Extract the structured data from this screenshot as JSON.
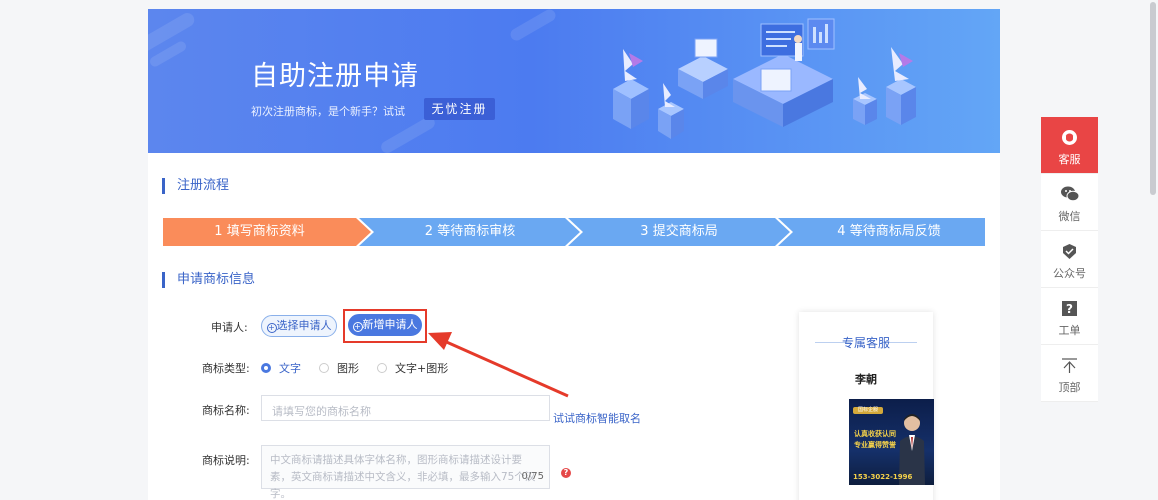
{
  "banner": {
    "title": "自助注册申请",
    "subtitle": "初次注册商标，是个新手？试试",
    "cta": "无忧注册"
  },
  "section_process": {
    "title": "注册流程"
  },
  "steps": [
    {
      "label": "1 填写商标资料",
      "color": "#fa8c5a"
    },
    {
      "label": "2 等待商标审核",
      "color": "#6aa8f2"
    },
    {
      "label": "3 提交商标局",
      "color": "#6aa8f2"
    },
    {
      "label": "4 等待商标局反馈",
      "color": "#6aa8f2"
    }
  ],
  "section_info": {
    "title": "申请商标信息"
  },
  "form": {
    "applicant": {
      "label": "申请人:",
      "select_button": "选择申请人",
      "add_button": "新增申请人"
    },
    "mark_type": {
      "label": "商标类型:",
      "options": [
        "文字",
        "图形",
        "文字+图形"
      ],
      "selected": "文字"
    },
    "mark_name": {
      "label": "商标名称:",
      "placeholder": "请填写您的商标名称",
      "ai_link": "试试商标智能取名"
    },
    "mark_desc": {
      "label": "商标说明:",
      "placeholder": "中文商标请描述具体字体名称，图形商标请描述设计要素，英文商标请描述中文含义，非必填，最多输入75个汉字。",
      "counter": "0/75",
      "help": "?"
    }
  },
  "service_card": {
    "title": "专属客服",
    "name": "李朝",
    "photo": {
      "badge": "国标企服",
      "line1": "认真收获认同",
      "line2": "专业赢得赞誉",
      "phone": "153-3022-1996"
    }
  },
  "sidebar": [
    {
      "label": "客服",
      "icon": "headset-icon",
      "active": true
    },
    {
      "label": "微信",
      "icon": "wechat-icon",
      "active": false
    },
    {
      "label": "公众号",
      "icon": "official-account-icon",
      "active": false
    },
    {
      "label": "工单",
      "icon": "ticket-icon",
      "active": false
    },
    {
      "label": "顶部",
      "icon": "back-to-top-icon",
      "active": false
    }
  ],
  "colors": {
    "accent": "#3a64c8",
    "primary_button": "#4a78e0",
    "step_active": "#fa8c5a",
    "step_inactive": "#6aa8f2",
    "highlight": "#e53a2a",
    "sidebar_active": "#e94545"
  }
}
